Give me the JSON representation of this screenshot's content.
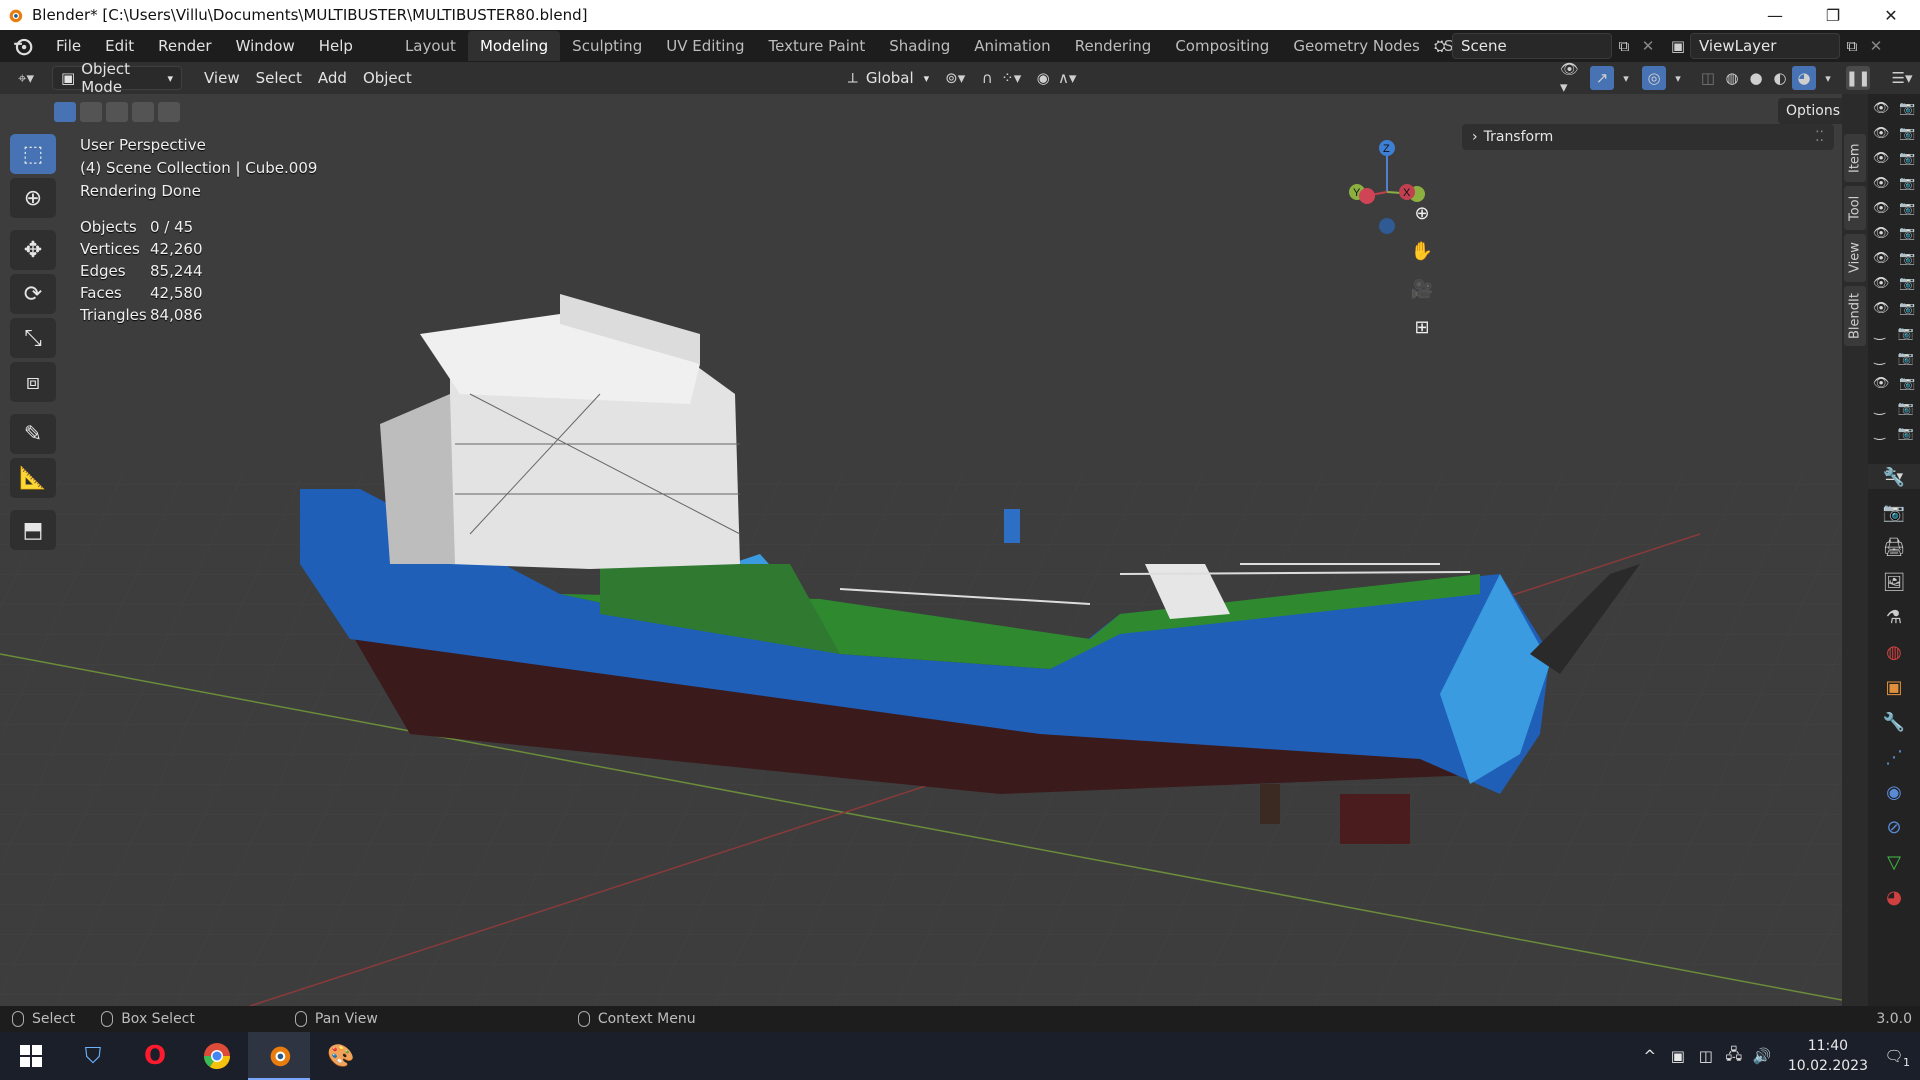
{
  "window": {
    "title": "Blender* [C:\\Users\\Villu\\Documents\\MULTIBUSTER\\MULTIBUSTER80.blend]",
    "controls": [
      "—",
      "❐",
      "✕"
    ]
  },
  "menu": [
    "File",
    "Edit",
    "Render",
    "Window",
    "Help"
  ],
  "workspaces": {
    "tabs": [
      "Layout",
      "Modeling",
      "Sculpting",
      "UV Editing",
      "Texture Paint",
      "Shading",
      "Animation",
      "Rendering",
      "Compositing",
      "Geometry Nodes",
      "Scripting"
    ],
    "active": "Modeling",
    "add_symbol": "+"
  },
  "scene": {
    "name": "Scene",
    "view_layer": "ViewLayer"
  },
  "header": {
    "mode": "Object Mode",
    "view": "View",
    "select": "Select",
    "add": "Add",
    "object": "Object",
    "transform_orientation": "Global",
    "options": "Options"
  },
  "viewport": {
    "info_line1": "User Perspective",
    "info_line2": "(4) Scene Collection | Cube.009",
    "info_line3": "Rendering Done",
    "stats": [
      {
        "label": "Objects",
        "value": "0 / 45"
      },
      {
        "label": "Vertices",
        "value": "42,260"
      },
      {
        "label": "Edges",
        "value": "85,244"
      },
      {
        "label": "Faces",
        "value": "42,580"
      },
      {
        "label": "Triangles",
        "value": "84,086"
      }
    ],
    "gizmo_axes": {
      "z": "Z",
      "y": "Y",
      "x": "X"
    }
  },
  "npanel": {
    "transform_label": "Transform",
    "tabs": [
      "Item",
      "Tool",
      "View",
      "BlendIt"
    ]
  },
  "statusbar": {
    "select": "Select",
    "box_select": "Box Select",
    "pan_view": "Pan View",
    "context_menu": "Context Menu",
    "version": "3.0.0"
  },
  "taskbar": {
    "time": "11:40",
    "date": "10.02.2023",
    "notification_count": "1"
  },
  "colors": {
    "accent": "#4772b3",
    "hull_blue": "#1f5fb8",
    "hull_light_blue": "#3a9be0",
    "hull_red": "#5a1f22",
    "deck_green": "#2f8a2f"
  }
}
